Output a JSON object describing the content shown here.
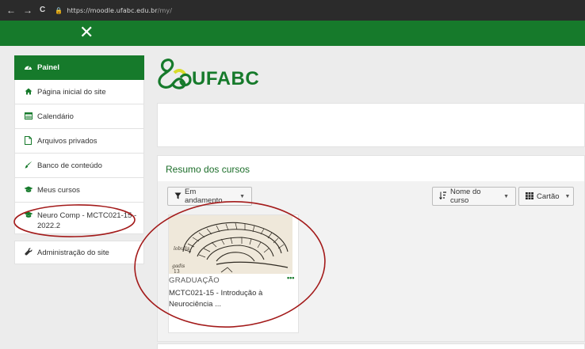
{
  "browser": {
    "back_icon": "←",
    "forward_icon": "→",
    "reload_icon": "C",
    "url_host": "https://moodle.ufabc.edu.br",
    "url_path": "/my/"
  },
  "header": {
    "close_icon": "✕"
  },
  "sidebar": {
    "items": [
      {
        "label": "Painel",
        "icon": "dashboard-icon"
      },
      {
        "label": "Página inicial do site",
        "icon": "home-icon"
      },
      {
        "label": "Calendário",
        "icon": "calendar-icon"
      },
      {
        "label": "Arquivos privados",
        "icon": "file-icon"
      },
      {
        "label": "Banco de conteúdo",
        "icon": "brush-icon"
      },
      {
        "label": "Meus cursos",
        "icon": "graduation-cap-icon"
      },
      {
        "label": "Neuro Comp - MCTC021-15 - 2022.2",
        "icon": "graduation-cap-icon"
      }
    ],
    "admin": {
      "label": "Administração do site",
      "icon": "wrench-icon"
    }
  },
  "logo": {
    "text": "UFABC"
  },
  "courses": {
    "title": "Resumo dos cursos",
    "filter_label": "Em andamento",
    "sort_label": "Nome do curso",
    "view_label": "Cartão",
    "course": {
      "category": "GRADUAÇÃO",
      "name": "MCTC021-15 - Introdução à Neurociência ...",
      "menu_icon": "•••"
    }
  },
  "colors": {
    "brand_green": "#167a2b",
    "annotation_red": "#a31a1a"
  }
}
